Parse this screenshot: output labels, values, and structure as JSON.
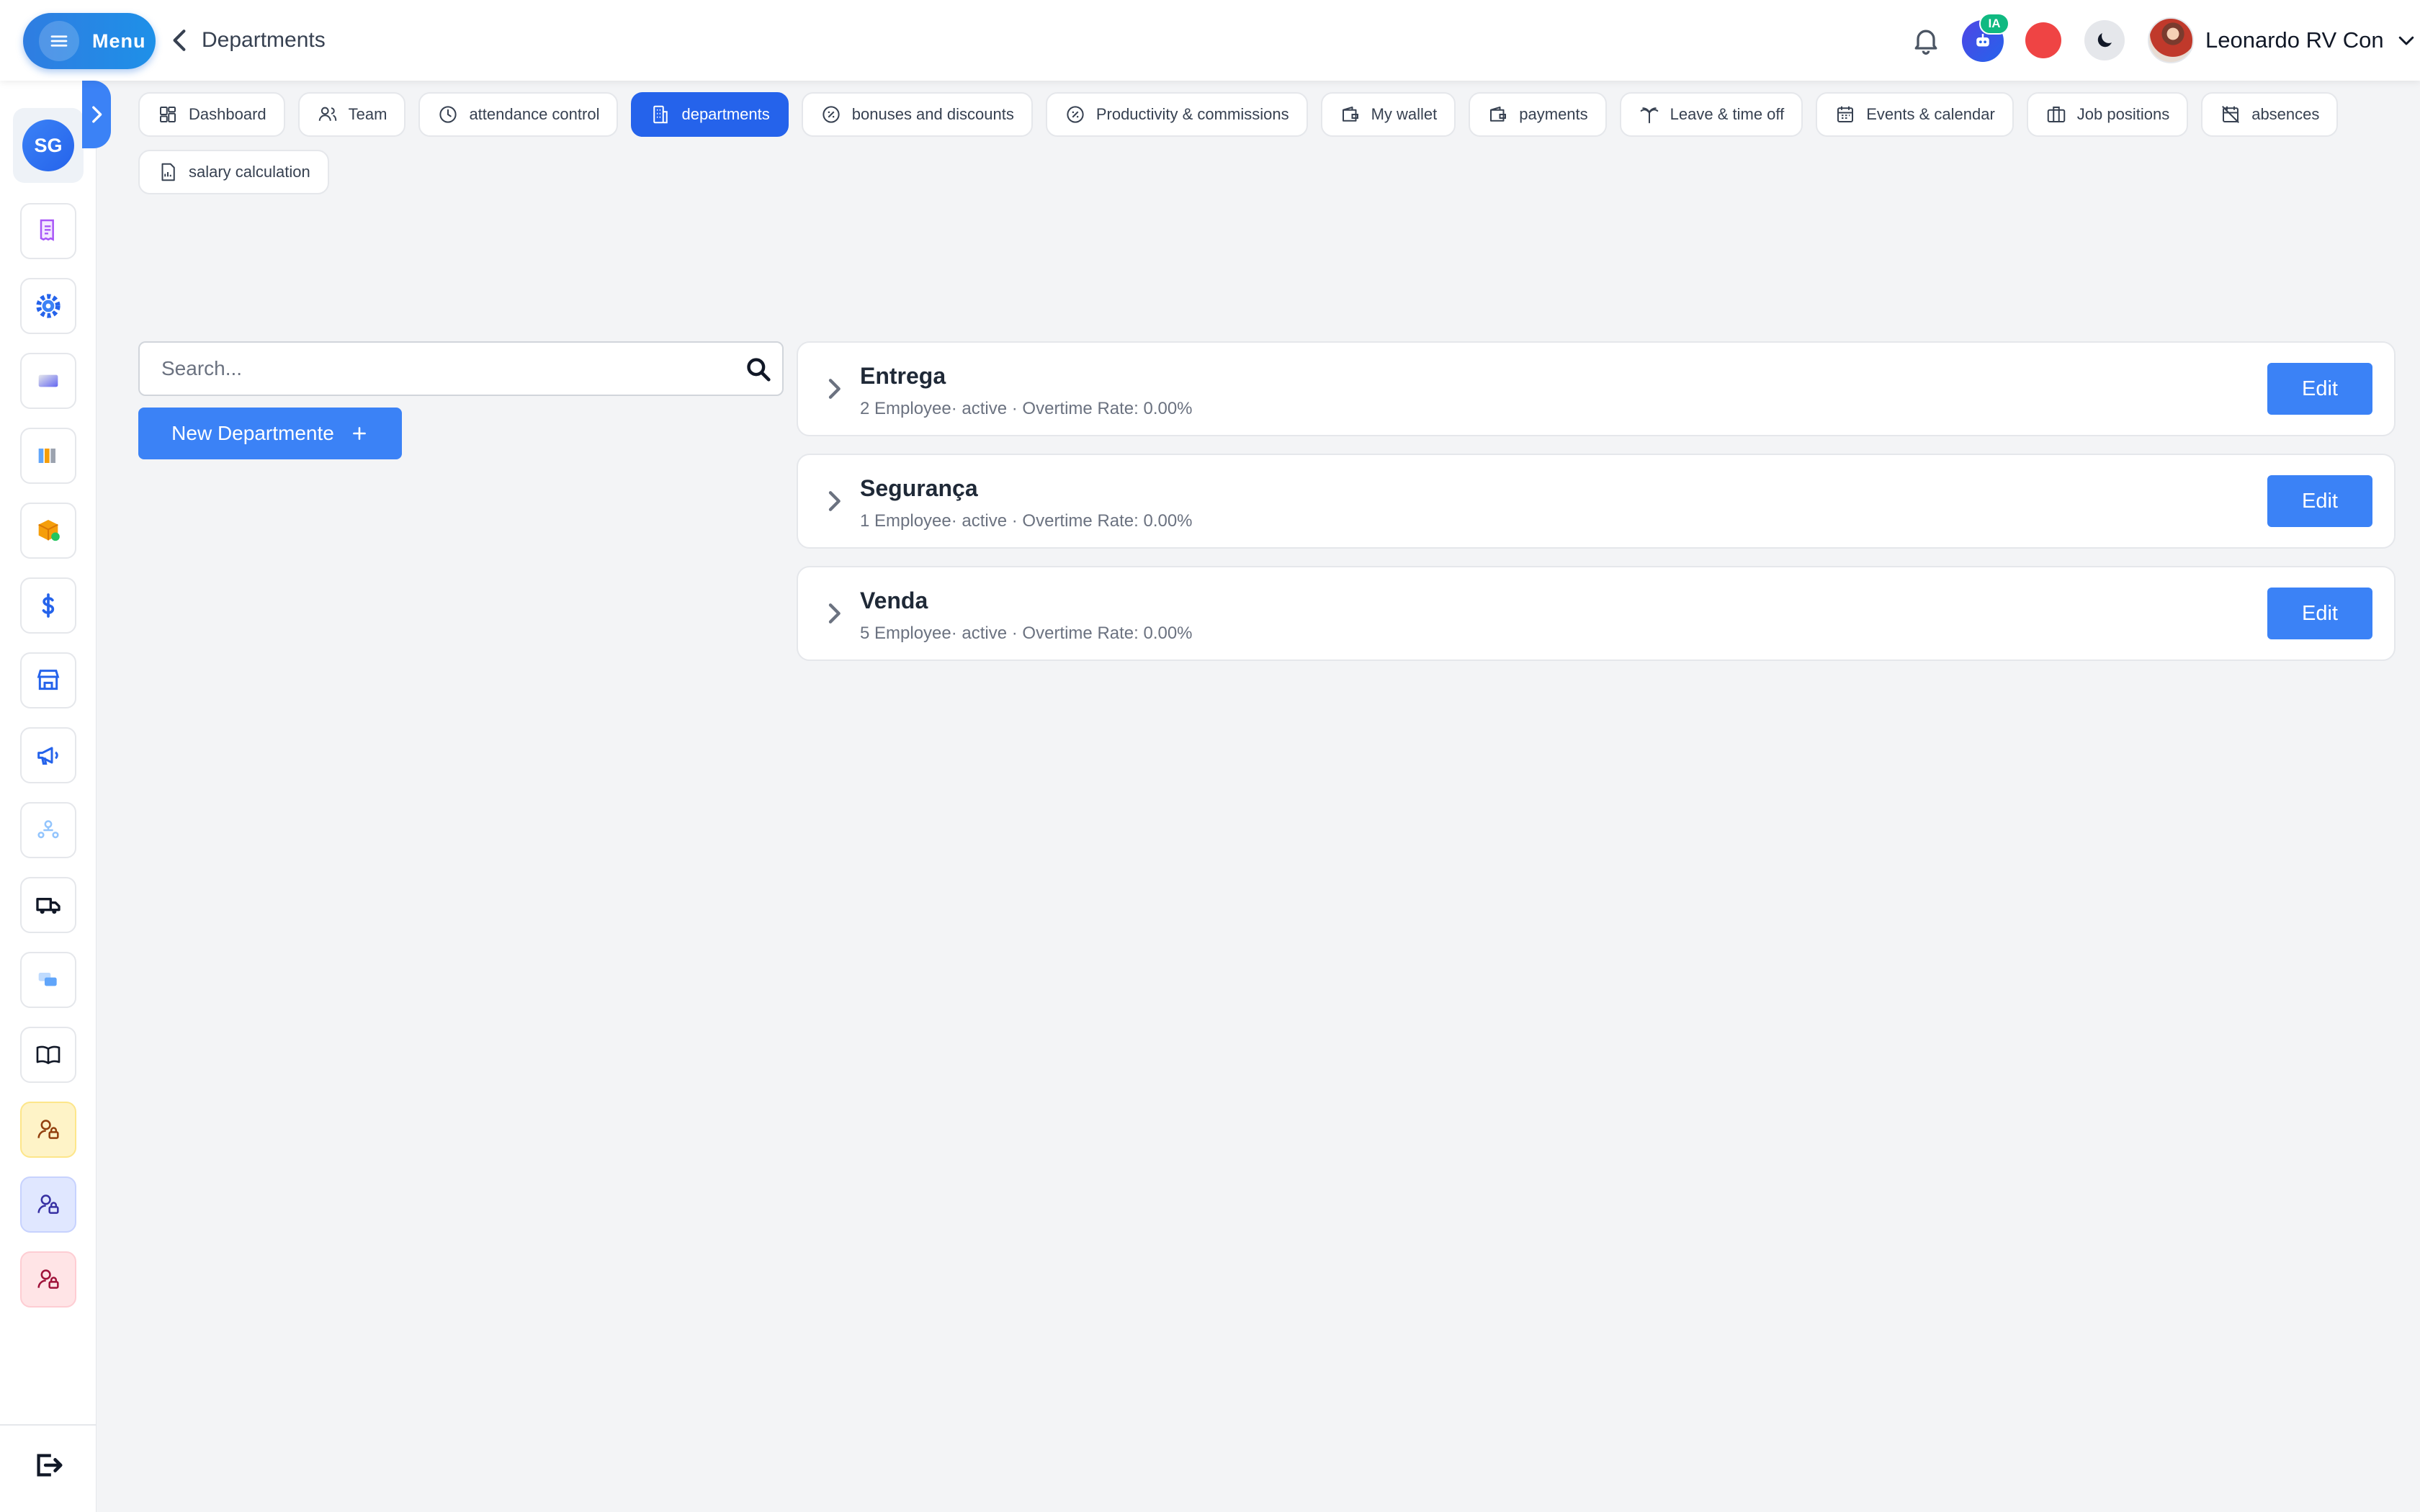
{
  "header": {
    "menu_label": "Menu",
    "page_title": "Departments",
    "ai_badge": "IA",
    "user_name": "Leonardo RV Con"
  },
  "sidebar": {
    "company_initials": "SG",
    "icons": [
      "receipt-icon",
      "settings-gear-icon",
      "gradient-card-icon",
      "books-icon",
      "package-icon",
      "dollar-icon",
      "store-icon",
      "megaphone-icon",
      "users-network-icon",
      "truck-icon",
      "chat-icon",
      "book-open-icon",
      "user-lock-icon",
      "user-lock-icon",
      "user-lock-icon",
      "logout-icon"
    ]
  },
  "tabs": [
    {
      "label": "Dashboard",
      "icon": "dashboard-icon"
    },
    {
      "label": "Team",
      "icon": "users-icon"
    },
    {
      "label": "attendance control",
      "icon": "clock-icon"
    },
    {
      "label": "departments",
      "icon": "building-icon",
      "active": true
    },
    {
      "label": "bonuses and discounts",
      "icon": "percent-badge-icon"
    },
    {
      "label": "Productivity & commissions",
      "icon": "percent-badge-icon"
    },
    {
      "label": "My wallet",
      "icon": "wallet-icon"
    },
    {
      "label": "payments",
      "icon": "wallet-icon"
    },
    {
      "label": "Leave & time off",
      "icon": "palm-tree-icon"
    },
    {
      "label": "Events & calendar",
      "icon": "calendar-icon"
    },
    {
      "label": "Job positions",
      "icon": "briefcase-icon"
    },
    {
      "label": "absences",
      "icon": "calendar-off-icon"
    },
    {
      "label": "salary calculation",
      "icon": "document-chart-icon"
    }
  ],
  "search": {
    "placeholder": "Search..."
  },
  "new_department_label": "New Departmente",
  "departments": [
    {
      "name": "Entrega",
      "meta": "2 Employee· active · Overtime Rate: 0.00%",
      "edit_label": "Edit"
    },
    {
      "name": "Segurança",
      "meta": "1 Employee· active · Overtime Rate: 0.00%",
      "edit_label": "Edit"
    },
    {
      "name": "Venda",
      "meta": "5 Employee· active · Overtime Rate: 0.00%",
      "edit_label": "Edit"
    }
  ],
  "colors": {
    "primary": "#3b82f6",
    "active_tab": "#2563eb",
    "ai_badge": "#10b981",
    "status_dot": "#ef4444",
    "background": "#f3f4f6"
  }
}
